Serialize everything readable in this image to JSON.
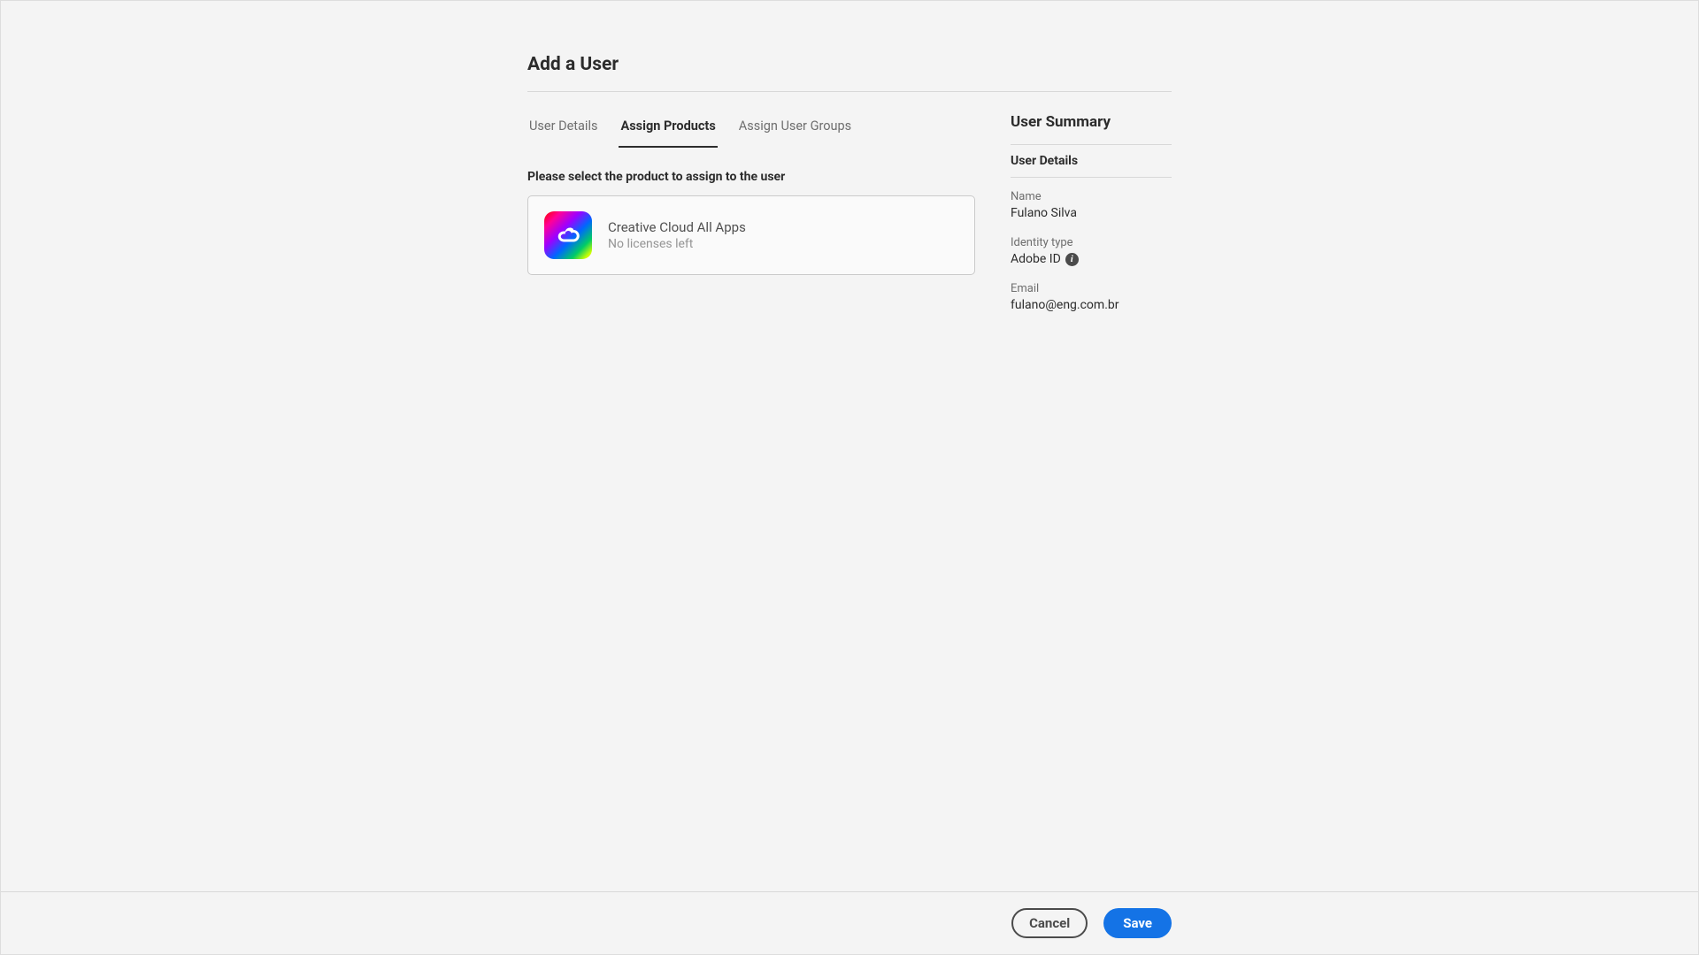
{
  "header": {
    "title": "Add a User"
  },
  "tabs": [
    {
      "label": "User Details",
      "active": false
    },
    {
      "label": "Assign Products",
      "active": true
    },
    {
      "label": "Assign User Groups",
      "active": false
    }
  ],
  "main": {
    "prompt": "Please select the product to assign to the user",
    "product": {
      "name": "Creative Cloud All Apps",
      "status": "No licenses left"
    }
  },
  "summary": {
    "title": "User Summary",
    "section_title": "User Details",
    "fields": {
      "name": {
        "label": "Name",
        "value": "Fulano Silva"
      },
      "identity": {
        "label": "Identity type",
        "value": "Adobe ID"
      },
      "email": {
        "label": "Email",
        "value": "fulano@eng.com.br"
      }
    }
  },
  "footer": {
    "cancel": "Cancel",
    "save": "Save"
  }
}
